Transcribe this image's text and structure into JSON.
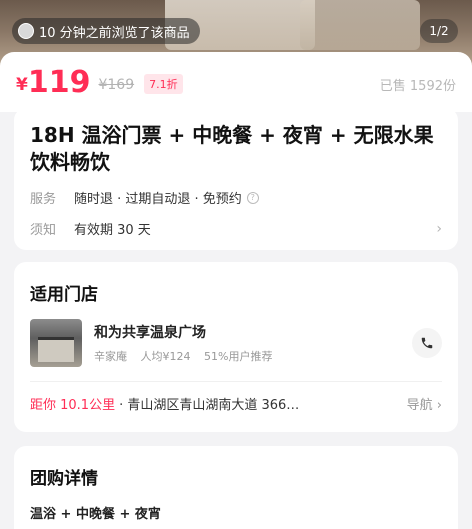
{
  "hero": {
    "toast_text": "10 分钟之前浏览了该商品",
    "pager": "1/2"
  },
  "price": {
    "currency": "¥",
    "value": "119",
    "original": "¥169",
    "discount": "7.1折",
    "sold": "已售 1592份"
  },
  "product": {
    "title": "18H 温浴门票 + 中晚餐 + 夜宵 + 无限水果饮料畅饮",
    "service_key": "服务",
    "service_value": "随时退 · 过期自动退 · 免预约",
    "notice_key": "须知",
    "notice_value": "有效期 30 天"
  },
  "store_section": {
    "title": "适用门店",
    "name": "和为共享温泉广场",
    "area": "辛家庵",
    "avg_price": "人均¥124",
    "recommend": "51%用户推荐",
    "distance": "距你 10.1公里",
    "separator": " · ",
    "address": "青山湖区青山湖南大道 366…",
    "nav_label": "导航 ›"
  },
  "deal_section": {
    "title": "团购详情",
    "line": "温浴 + 中晚餐 + 夜宵"
  },
  "colors": {
    "accent": "#ff2d55",
    "background": "#f3f3f5"
  },
  "icons": {
    "phone": "phone-icon",
    "info": "info-icon",
    "chevron": "chevron-right-icon"
  }
}
